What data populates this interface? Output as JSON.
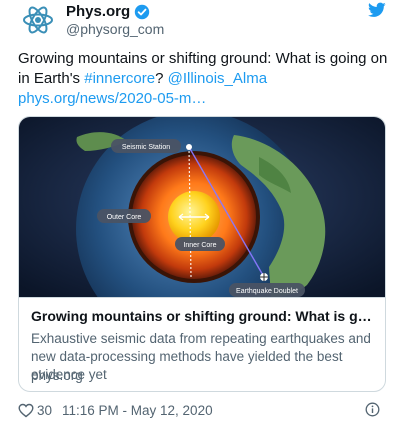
{
  "account": {
    "display_name": "Phys.org",
    "handle": "@physorg_com",
    "avatar_icon": "atom-icon",
    "verified_icon": "verified-badge-icon",
    "platform_icon": "twitter-bird-icon"
  },
  "tweet": {
    "text_plain": "Growing mountains or shifting ground: What is going on in Earth's ",
    "hashtag": "#innercore",
    "text_after_hashtag": "? ",
    "mention": "@Illinois_Alma",
    "url": "phys.org/news/2020-05-m…"
  },
  "card": {
    "image_labels": {
      "seismic_station": "Seismic Station",
      "outer_core": "Outer Core",
      "inner_core": "Inner Core",
      "earthquake_doublet": "Earthquake Doublet"
    },
    "title": "Growing mountains or shifting ground: What is going o...",
    "description": "Exhaustive seismic data from repeating earthquakes and new data-processing methods have yielded the best evidence yet",
    "domain": "phys.org"
  },
  "footer": {
    "like_count": "30",
    "timestamp": "11:16 PM - May 12, 2020",
    "heart_icon": "heart-icon",
    "info_icon": "info-icon"
  },
  "colors": {
    "link": "#1d9bf0",
    "secondary_text": "#536471",
    "border": "#cfd9de"
  }
}
